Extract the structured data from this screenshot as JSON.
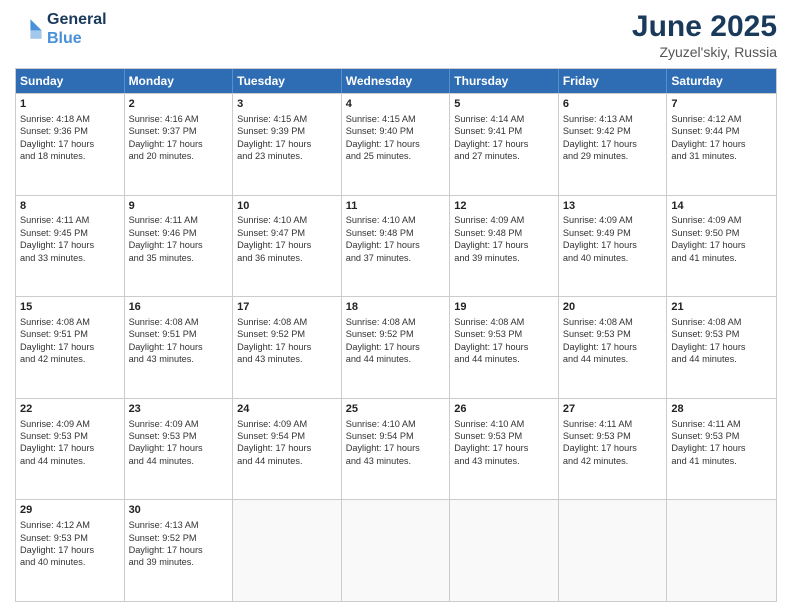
{
  "header": {
    "logo_line1": "General",
    "logo_line2": "Blue",
    "month_year": "June 2025",
    "location": "Zyuzel'skiy, Russia"
  },
  "days_of_week": [
    "Sunday",
    "Monday",
    "Tuesday",
    "Wednesday",
    "Thursday",
    "Friday",
    "Saturday"
  ],
  "weeks": [
    [
      {
        "day": "1",
        "lines": [
          "Sunrise: 4:18 AM",
          "Sunset: 9:36 PM",
          "Daylight: 17 hours",
          "and 18 minutes."
        ]
      },
      {
        "day": "2",
        "lines": [
          "Sunrise: 4:16 AM",
          "Sunset: 9:37 PM",
          "Daylight: 17 hours",
          "and 20 minutes."
        ]
      },
      {
        "day": "3",
        "lines": [
          "Sunrise: 4:15 AM",
          "Sunset: 9:39 PM",
          "Daylight: 17 hours",
          "and 23 minutes."
        ]
      },
      {
        "day": "4",
        "lines": [
          "Sunrise: 4:15 AM",
          "Sunset: 9:40 PM",
          "Daylight: 17 hours",
          "and 25 minutes."
        ]
      },
      {
        "day": "5",
        "lines": [
          "Sunrise: 4:14 AM",
          "Sunset: 9:41 PM",
          "Daylight: 17 hours",
          "and 27 minutes."
        ]
      },
      {
        "day": "6",
        "lines": [
          "Sunrise: 4:13 AM",
          "Sunset: 9:42 PM",
          "Daylight: 17 hours",
          "and 29 minutes."
        ]
      },
      {
        "day": "7",
        "lines": [
          "Sunrise: 4:12 AM",
          "Sunset: 9:44 PM",
          "Daylight: 17 hours",
          "and 31 minutes."
        ]
      }
    ],
    [
      {
        "day": "8",
        "lines": [
          "Sunrise: 4:11 AM",
          "Sunset: 9:45 PM",
          "Daylight: 17 hours",
          "and 33 minutes."
        ]
      },
      {
        "day": "9",
        "lines": [
          "Sunrise: 4:11 AM",
          "Sunset: 9:46 PM",
          "Daylight: 17 hours",
          "and 35 minutes."
        ]
      },
      {
        "day": "10",
        "lines": [
          "Sunrise: 4:10 AM",
          "Sunset: 9:47 PM",
          "Daylight: 17 hours",
          "and 36 minutes."
        ]
      },
      {
        "day": "11",
        "lines": [
          "Sunrise: 4:10 AM",
          "Sunset: 9:48 PM",
          "Daylight: 17 hours",
          "and 37 minutes."
        ]
      },
      {
        "day": "12",
        "lines": [
          "Sunrise: 4:09 AM",
          "Sunset: 9:48 PM",
          "Daylight: 17 hours",
          "and 39 minutes."
        ]
      },
      {
        "day": "13",
        "lines": [
          "Sunrise: 4:09 AM",
          "Sunset: 9:49 PM",
          "Daylight: 17 hours",
          "and 40 minutes."
        ]
      },
      {
        "day": "14",
        "lines": [
          "Sunrise: 4:09 AM",
          "Sunset: 9:50 PM",
          "Daylight: 17 hours",
          "and 41 minutes."
        ]
      }
    ],
    [
      {
        "day": "15",
        "lines": [
          "Sunrise: 4:08 AM",
          "Sunset: 9:51 PM",
          "Daylight: 17 hours",
          "and 42 minutes."
        ]
      },
      {
        "day": "16",
        "lines": [
          "Sunrise: 4:08 AM",
          "Sunset: 9:51 PM",
          "Daylight: 17 hours",
          "and 43 minutes."
        ]
      },
      {
        "day": "17",
        "lines": [
          "Sunrise: 4:08 AM",
          "Sunset: 9:52 PM",
          "Daylight: 17 hours",
          "and 43 minutes."
        ]
      },
      {
        "day": "18",
        "lines": [
          "Sunrise: 4:08 AM",
          "Sunset: 9:52 PM",
          "Daylight: 17 hours",
          "and 44 minutes."
        ]
      },
      {
        "day": "19",
        "lines": [
          "Sunrise: 4:08 AM",
          "Sunset: 9:53 PM",
          "Daylight: 17 hours",
          "and 44 minutes."
        ]
      },
      {
        "day": "20",
        "lines": [
          "Sunrise: 4:08 AM",
          "Sunset: 9:53 PM",
          "Daylight: 17 hours",
          "and 44 minutes."
        ]
      },
      {
        "day": "21",
        "lines": [
          "Sunrise: 4:08 AM",
          "Sunset: 9:53 PM",
          "Daylight: 17 hours",
          "and 44 minutes."
        ]
      }
    ],
    [
      {
        "day": "22",
        "lines": [
          "Sunrise: 4:09 AM",
          "Sunset: 9:53 PM",
          "Daylight: 17 hours",
          "and 44 minutes."
        ]
      },
      {
        "day": "23",
        "lines": [
          "Sunrise: 4:09 AM",
          "Sunset: 9:53 PM",
          "Daylight: 17 hours",
          "and 44 minutes."
        ]
      },
      {
        "day": "24",
        "lines": [
          "Sunrise: 4:09 AM",
          "Sunset: 9:54 PM",
          "Daylight: 17 hours",
          "and 44 minutes."
        ]
      },
      {
        "day": "25",
        "lines": [
          "Sunrise: 4:10 AM",
          "Sunset: 9:54 PM",
          "Daylight: 17 hours",
          "and 43 minutes."
        ]
      },
      {
        "day": "26",
        "lines": [
          "Sunrise: 4:10 AM",
          "Sunset: 9:53 PM",
          "Daylight: 17 hours",
          "and 43 minutes."
        ]
      },
      {
        "day": "27",
        "lines": [
          "Sunrise: 4:11 AM",
          "Sunset: 9:53 PM",
          "Daylight: 17 hours",
          "and 42 minutes."
        ]
      },
      {
        "day": "28",
        "lines": [
          "Sunrise: 4:11 AM",
          "Sunset: 9:53 PM",
          "Daylight: 17 hours",
          "and 41 minutes."
        ]
      }
    ],
    [
      {
        "day": "29",
        "lines": [
          "Sunrise: 4:12 AM",
          "Sunset: 9:53 PM",
          "Daylight: 17 hours",
          "and 40 minutes."
        ]
      },
      {
        "day": "30",
        "lines": [
          "Sunrise: 4:13 AM",
          "Sunset: 9:52 PM",
          "Daylight: 17 hours",
          "and 39 minutes."
        ]
      },
      {
        "day": "",
        "lines": []
      },
      {
        "day": "",
        "lines": []
      },
      {
        "day": "",
        "lines": []
      },
      {
        "day": "",
        "lines": []
      },
      {
        "day": "",
        "lines": []
      }
    ]
  ]
}
